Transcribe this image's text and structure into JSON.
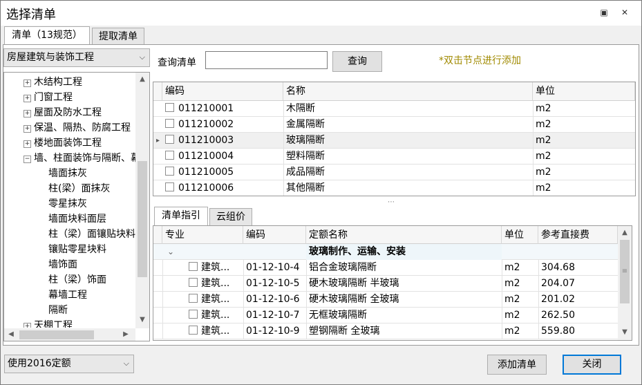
{
  "window": {
    "title": "选择清单",
    "restore_icon": "restore-icon",
    "close_icon": "close-icon",
    "close_glyph": "✕",
    "restore_glyph": "▣"
  },
  "tabs": [
    {
      "label": "清单（13规范）"
    },
    {
      "label": "提取清单"
    }
  ],
  "left": {
    "combo_value": "房屋建筑与装饰工程",
    "tree": [
      {
        "label": "木结构工程",
        "expander": "+"
      },
      {
        "label": "门窗工程",
        "expander": "+"
      },
      {
        "label": "屋面及防水工程",
        "expander": "+"
      },
      {
        "label": "保温、隔热、防腐工程",
        "expander": "+"
      },
      {
        "label": "楼地面装饰工程",
        "expander": "+"
      },
      {
        "label": "墙、柱面装饰与隔断、幕墙工程",
        "expander": "−"
      },
      {
        "label": "墙面抹灰"
      },
      {
        "label": "柱(梁）面抹灰"
      },
      {
        "label": "零星抹灰"
      },
      {
        "label": "墙面块料面层"
      },
      {
        "label": "柱（梁）面镶贴块料"
      },
      {
        "label": "镶贴零星块料"
      },
      {
        "label": "墙饰面"
      },
      {
        "label": "柱（梁）饰面"
      },
      {
        "label": "幕墙工程"
      },
      {
        "label": "隔断"
      },
      {
        "label": "天棚工程",
        "expander": "+"
      }
    ]
  },
  "search": {
    "label": "查询清单",
    "value": "",
    "button": "查询",
    "hint": "*双击节点进行添加"
  },
  "list_grid": {
    "headers": [
      "编码",
      "名称",
      "单位"
    ],
    "rows": [
      {
        "code": "011210001",
        "name": "木隔断",
        "unit": "m2"
      },
      {
        "code": "011210002",
        "name": "金属隔断",
        "unit": "m2"
      },
      {
        "code": "011210003",
        "name": "玻璃隔断",
        "unit": "m2"
      },
      {
        "code": "011210004",
        "name": "塑料隔断",
        "unit": "m2"
      },
      {
        "code": "011210005",
        "name": "成品隔断",
        "unit": "m2"
      },
      {
        "code": "011210006",
        "name": "其他隔断",
        "unit": "m2"
      }
    ],
    "current_row_marker": "▸"
  },
  "lower_tabs": [
    {
      "label": "清单指引"
    },
    {
      "label": "云组价"
    }
  ],
  "quota_grid": {
    "headers": [
      "专业",
      "编码",
      "定额名称",
      "单位",
      "参考直接费"
    ],
    "group": {
      "toggle": "⌄",
      "name": "玻璃制作、运输、安装"
    },
    "rows": [
      {
        "major": "建筑...",
        "code": "01-12-10-4",
        "name": "铝合金玻璃隔断",
        "unit": "m2",
        "fee": "304.68"
      },
      {
        "major": "建筑...",
        "code": "01-12-10-5",
        "name": "硬木玻璃隔断 半玻璃",
        "unit": "m2",
        "fee": "204.07"
      },
      {
        "major": "建筑...",
        "code": "01-12-10-6",
        "name": "硬木玻璃隔断 全玻璃",
        "unit": "m2",
        "fee": "201.02"
      },
      {
        "major": "建筑...",
        "code": "01-12-10-7",
        "name": "无框玻璃隔断",
        "unit": "m2",
        "fee": "262.50"
      },
      {
        "major": "建筑...",
        "code": "01-12-10-9",
        "name": "塑钢隔断 全玻璃",
        "unit": "m2",
        "fee": "559.80"
      }
    ]
  },
  "footer": {
    "quota_combo": "使用2016定额",
    "add_button": "添加清单",
    "close_button": "关闭"
  },
  "glyphs": {
    "up": "▲",
    "down": "▼",
    "left": "◀",
    "right": "▶",
    "combo": "⌵",
    "grip": "⋯",
    "vgrip": "≡"
  }
}
